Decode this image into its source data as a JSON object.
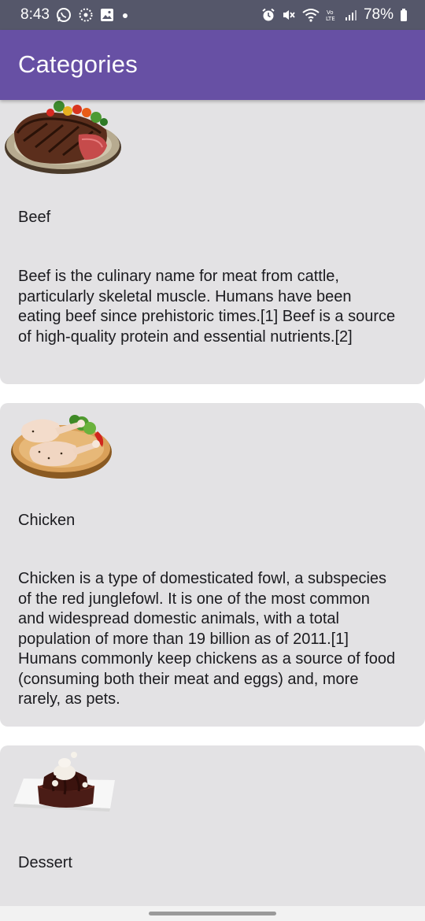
{
  "status_bar": {
    "time": "8:43",
    "battery": "78%",
    "icons": [
      "whatsapp-icon",
      "settings-dots-icon",
      "gallery-icon",
      "notification-dot-icon",
      "alarm-icon",
      "mute-icon",
      "wifi-icon",
      "volte-icon",
      "signal-icon",
      "battery-icon"
    ]
  },
  "app_bar": {
    "title": "Categories"
  },
  "categories": [
    {
      "name": "Beef",
      "image": "steak-plate-image",
      "description": "Beef is the culinary name for meat from cattle, particularly skeletal muscle. Humans have been eating beef since prehistoric times.[1] Beef is a source of high-quality protein and essential nutrients.[2]"
    },
    {
      "name": "Chicken",
      "image": "chicken-legs-image",
      "description": "Chicken is a type of domesticated fowl, a subspecies of the red junglefowl. It is one of the most common and widespread domestic animals, with a total population of more than 19 billion as of 2011.[1] Humans commonly keep chickens as a source of food (consuming both their meat and eggs) and, more rarely, as pets."
    },
    {
      "name": "Dessert",
      "image": "brownie-dessert-image",
      "description": ""
    }
  ],
  "colors": {
    "status_bar": "#55576a",
    "app_bar": "#6750a4",
    "card": "#e3e2e4"
  }
}
